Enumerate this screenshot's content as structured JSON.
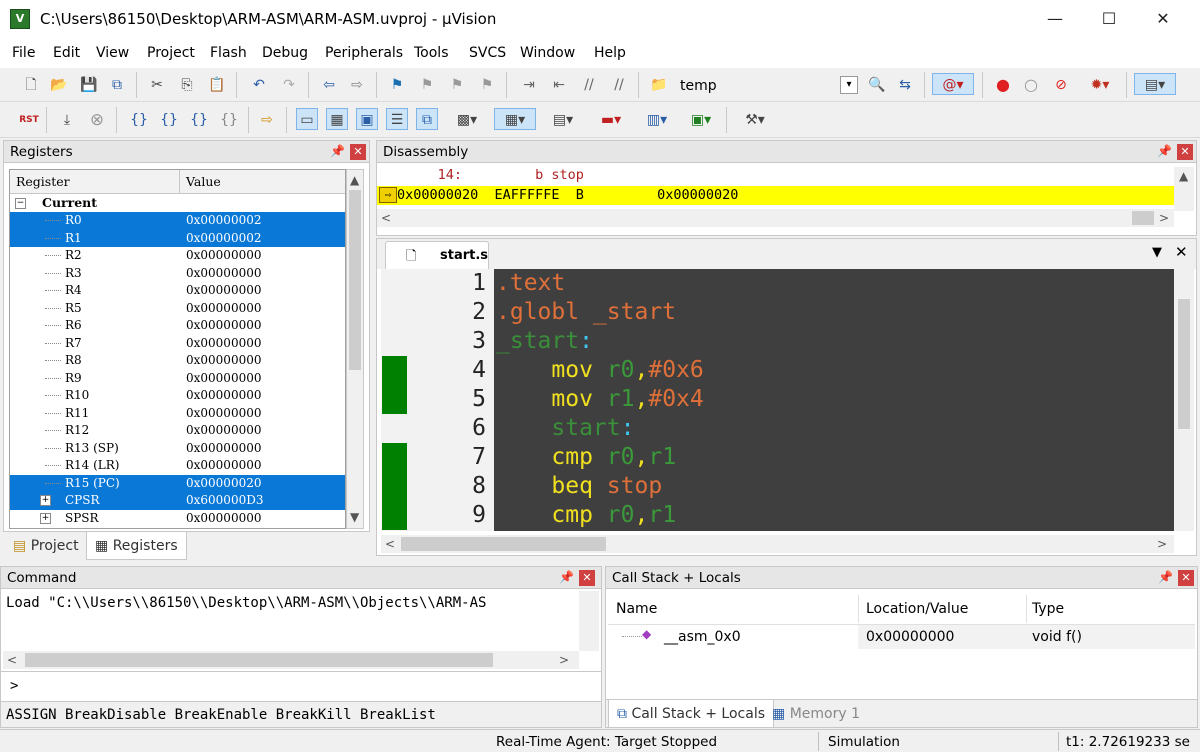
{
  "window": {
    "title": "C:\\Users\\86150\\Desktop\\ARM-ASM\\ARM-ASM.uvproj - µVision",
    "app_icon_text": "V",
    "minimize": "—",
    "maximize": "☐",
    "close": "✕"
  },
  "menu": [
    "File",
    "Edit",
    "View",
    "Project",
    "Flash",
    "Debug",
    "Peripherals",
    "Tools",
    "SVCS",
    "Window",
    "Help"
  ],
  "toolbar": {
    "target_name": "temp",
    "rst_label": "RST"
  },
  "registers": {
    "panel_title": "Registers",
    "col_register": "Register",
    "col_value": "Value",
    "group": "Current",
    "rows": [
      {
        "name": "R0",
        "value": "0x00000002",
        "selected": true
      },
      {
        "name": "R1",
        "value": "0x00000002",
        "selected": true
      },
      {
        "name": "R2",
        "value": "0x00000000",
        "selected": false
      },
      {
        "name": "R3",
        "value": "0x00000000",
        "selected": false
      },
      {
        "name": "R4",
        "value": "0x00000000",
        "selected": false
      },
      {
        "name": "R5",
        "value": "0x00000000",
        "selected": false
      },
      {
        "name": "R6",
        "value": "0x00000000",
        "selected": false
      },
      {
        "name": "R7",
        "value": "0x00000000",
        "selected": false
      },
      {
        "name": "R8",
        "value": "0x00000000",
        "selected": false
      },
      {
        "name": "R9",
        "value": "0x00000000",
        "selected": false
      },
      {
        "name": "R10",
        "value": "0x00000000",
        "selected": false
      },
      {
        "name": "R11",
        "value": "0x00000000",
        "selected": false
      },
      {
        "name": "R12",
        "value": "0x00000000",
        "selected": false
      },
      {
        "name": "R13 (SP)",
        "value": "0x00000000",
        "selected": false
      },
      {
        "name": "R14 (LR)",
        "value": "0x00000000",
        "selected": false
      },
      {
        "name": "R15 (PC)",
        "value": "0x00000020",
        "selected": true
      },
      {
        "name": "CPSR",
        "value": "0x600000D3",
        "selected": true
      },
      {
        "name": "SPSR",
        "value": "0x00000000",
        "selected": false
      }
    ],
    "tabs": {
      "project": "Project",
      "registers": "Registers"
    }
  },
  "disassembly": {
    "panel_title": "Disassembly",
    "source_line": "     14:         b stop",
    "current_line": "0x00000020  EAFFFFFE  B         0x00000020"
  },
  "editor": {
    "tab": "start.s",
    "lines": [
      {
        "n": "1",
        "mark": false,
        "tokens": [
          {
            "t": ".text",
            "c": "#e0703a"
          }
        ]
      },
      {
        "n": "2",
        "mark": false,
        "tokens": [
          {
            "t": ".globl _start",
            "c": "#e0703a"
          }
        ]
      },
      {
        "n": "3",
        "mark": false,
        "tokens": [
          {
            "t": "_start",
            "c": "#3a8f3a"
          },
          {
            "t": ":",
            "c": "#3ec8f0"
          }
        ]
      },
      {
        "n": "4",
        "mark": true,
        "tokens": [
          {
            "t": "    mov ",
            "c": "#f0e020"
          },
          {
            "t": "r0",
            "c": "#3a9a3a"
          },
          {
            "t": ",",
            "c": "#f0e020"
          },
          {
            "t": "#0x6",
            "c": "#e0703a"
          }
        ]
      },
      {
        "n": "5",
        "mark": true,
        "tokens": [
          {
            "t": "    mov ",
            "c": "#f0e020"
          },
          {
            "t": "r1",
            "c": "#3a9a3a"
          },
          {
            "t": ",",
            "c": "#f0e020"
          },
          {
            "t": "#0x4",
            "c": "#e0703a"
          }
        ]
      },
      {
        "n": "6",
        "mark": false,
        "tokens": [
          {
            "t": "    start",
            "c": "#3a8f3a"
          },
          {
            "t": ":",
            "c": "#3ec8f0"
          }
        ]
      },
      {
        "n": "7",
        "mark": true,
        "tokens": [
          {
            "t": "    cmp ",
            "c": "#f0e020"
          },
          {
            "t": "r0",
            "c": "#3a9a3a"
          },
          {
            "t": ",",
            "c": "#f0e020"
          },
          {
            "t": "r1",
            "c": "#3a9a3a"
          }
        ]
      },
      {
        "n": "8",
        "mark": true,
        "tokens": [
          {
            "t": "    beq ",
            "c": "#f0e020"
          },
          {
            "t": "stop",
            "c": "#e0703a"
          }
        ]
      },
      {
        "n": "9",
        "mark": true,
        "tokens": [
          {
            "t": "    cmp ",
            "c": "#f0e020"
          },
          {
            "t": "r0",
            "c": "#3a9a3a"
          },
          {
            "t": ",",
            "c": "#f0e020"
          },
          {
            "t": "r1",
            "c": "#3a9a3a"
          }
        ]
      }
    ]
  },
  "command": {
    "panel_title": "Command",
    "output": "Load \"C:\\\\Users\\\\86150\\\\Desktop\\\\ARM-ASM\\\\Objects\\\\ARM-AS",
    "prompt": ">",
    "hints": "ASSIGN BreakDisable BreakEnable BreakKill BreakList"
  },
  "callstack": {
    "panel_title": "Call Stack + Locals",
    "col_name": "Name",
    "col_location": "Location/Value",
    "col_type": "Type",
    "row": {
      "name": "__asm_0x0",
      "location": "0x00000000",
      "type": "void f()"
    },
    "tabs": {
      "callstack": "Call Stack + Locals",
      "memory": "Memory 1"
    }
  },
  "status": {
    "agent": "Real-Time Agent: Target Stopped",
    "mode": "Simulation",
    "time": "t1: 2.72619233 se"
  },
  "colors": {
    "selection": "#0a78d7",
    "current_line": "#ffff00",
    "editor_bg": "#3f3f3f",
    "breakmark": "#008000"
  }
}
